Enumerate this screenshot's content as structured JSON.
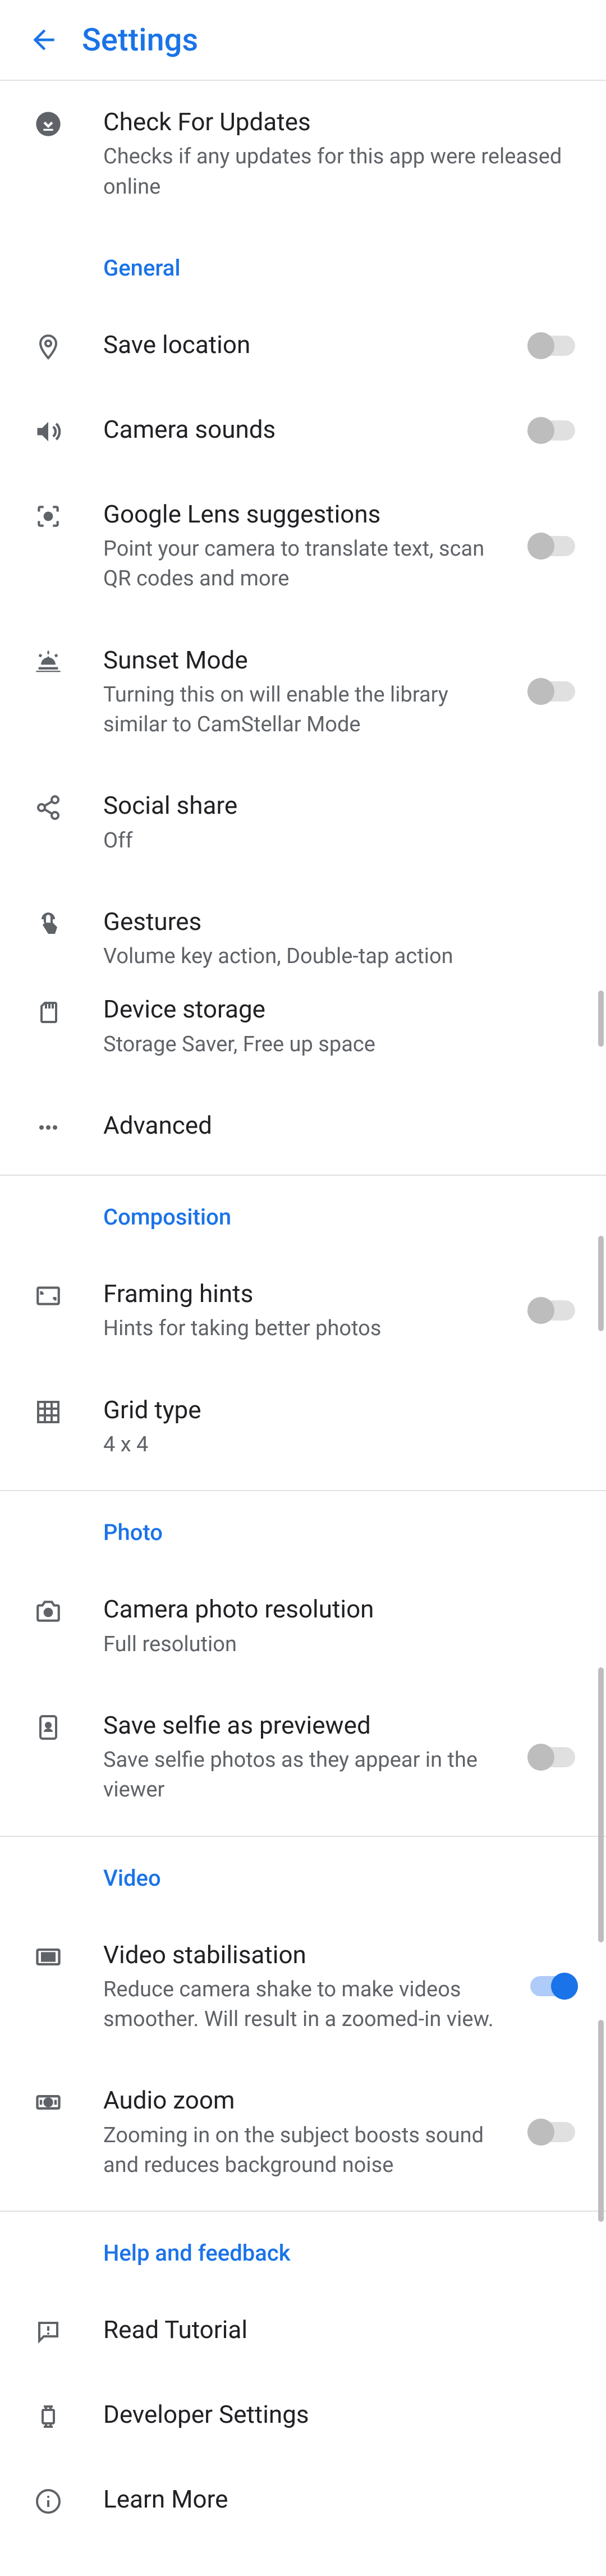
{
  "header": {
    "title": "Settings"
  },
  "rows": {
    "check_updates": {
      "title": "Check For Updates",
      "subtitle": "Checks if any updates for this app were released online"
    },
    "section_general": "General",
    "save_location": {
      "title": "Save location"
    },
    "camera_sounds": {
      "title": "Camera sounds"
    },
    "google_lens": {
      "title": "Google Lens suggestions",
      "subtitle": "Point your camera to translate text, scan QR codes and more"
    },
    "sunset_mode": {
      "title": "Sunset Mode",
      "subtitle": "Turning this on will enable the library similar to CamStellar Mode"
    },
    "social_share": {
      "title": "Social share",
      "subtitle": "Off"
    },
    "gestures": {
      "title": "Gestures",
      "subtitle": "Volume key action, Double-tap action"
    },
    "device_storage": {
      "title": "Device storage",
      "subtitle": "Storage Saver, Free up space"
    },
    "advanced": {
      "title": "Advanced"
    },
    "section_composition": "Composition",
    "framing_hints": {
      "title": "Framing hints",
      "subtitle": "Hints for taking better photos"
    },
    "grid_type": {
      "title": "Grid type",
      "subtitle": "4 x 4"
    },
    "section_photo": "Photo",
    "photo_resolution": {
      "title": "Camera photo resolution",
      "subtitle": "Full resolution"
    },
    "save_selfie": {
      "title": "Save selfie as previewed",
      "subtitle": "Save selfie photos as they appear in the viewer"
    },
    "section_video": "Video",
    "video_stab": {
      "title": "Video stabilisation",
      "subtitle": "Reduce camera shake to make videos smoother. Will result in a zoomed-in view."
    },
    "audio_zoom": {
      "title": "Audio zoom",
      "subtitle": "Zooming in on the subject boosts sound and reduces background noise"
    },
    "section_help": "Help and feedback",
    "read_tutorial": {
      "title": "Read Tutorial"
    },
    "developer_settings": {
      "title": "Developer Settings"
    },
    "learn_more": {
      "title": "Learn More"
    }
  },
  "switches": {
    "save_location": false,
    "camera_sounds": false,
    "google_lens": false,
    "sunset_mode": false,
    "framing_hints": false,
    "save_selfie": false,
    "video_stab": true,
    "audio_zoom": false
  }
}
